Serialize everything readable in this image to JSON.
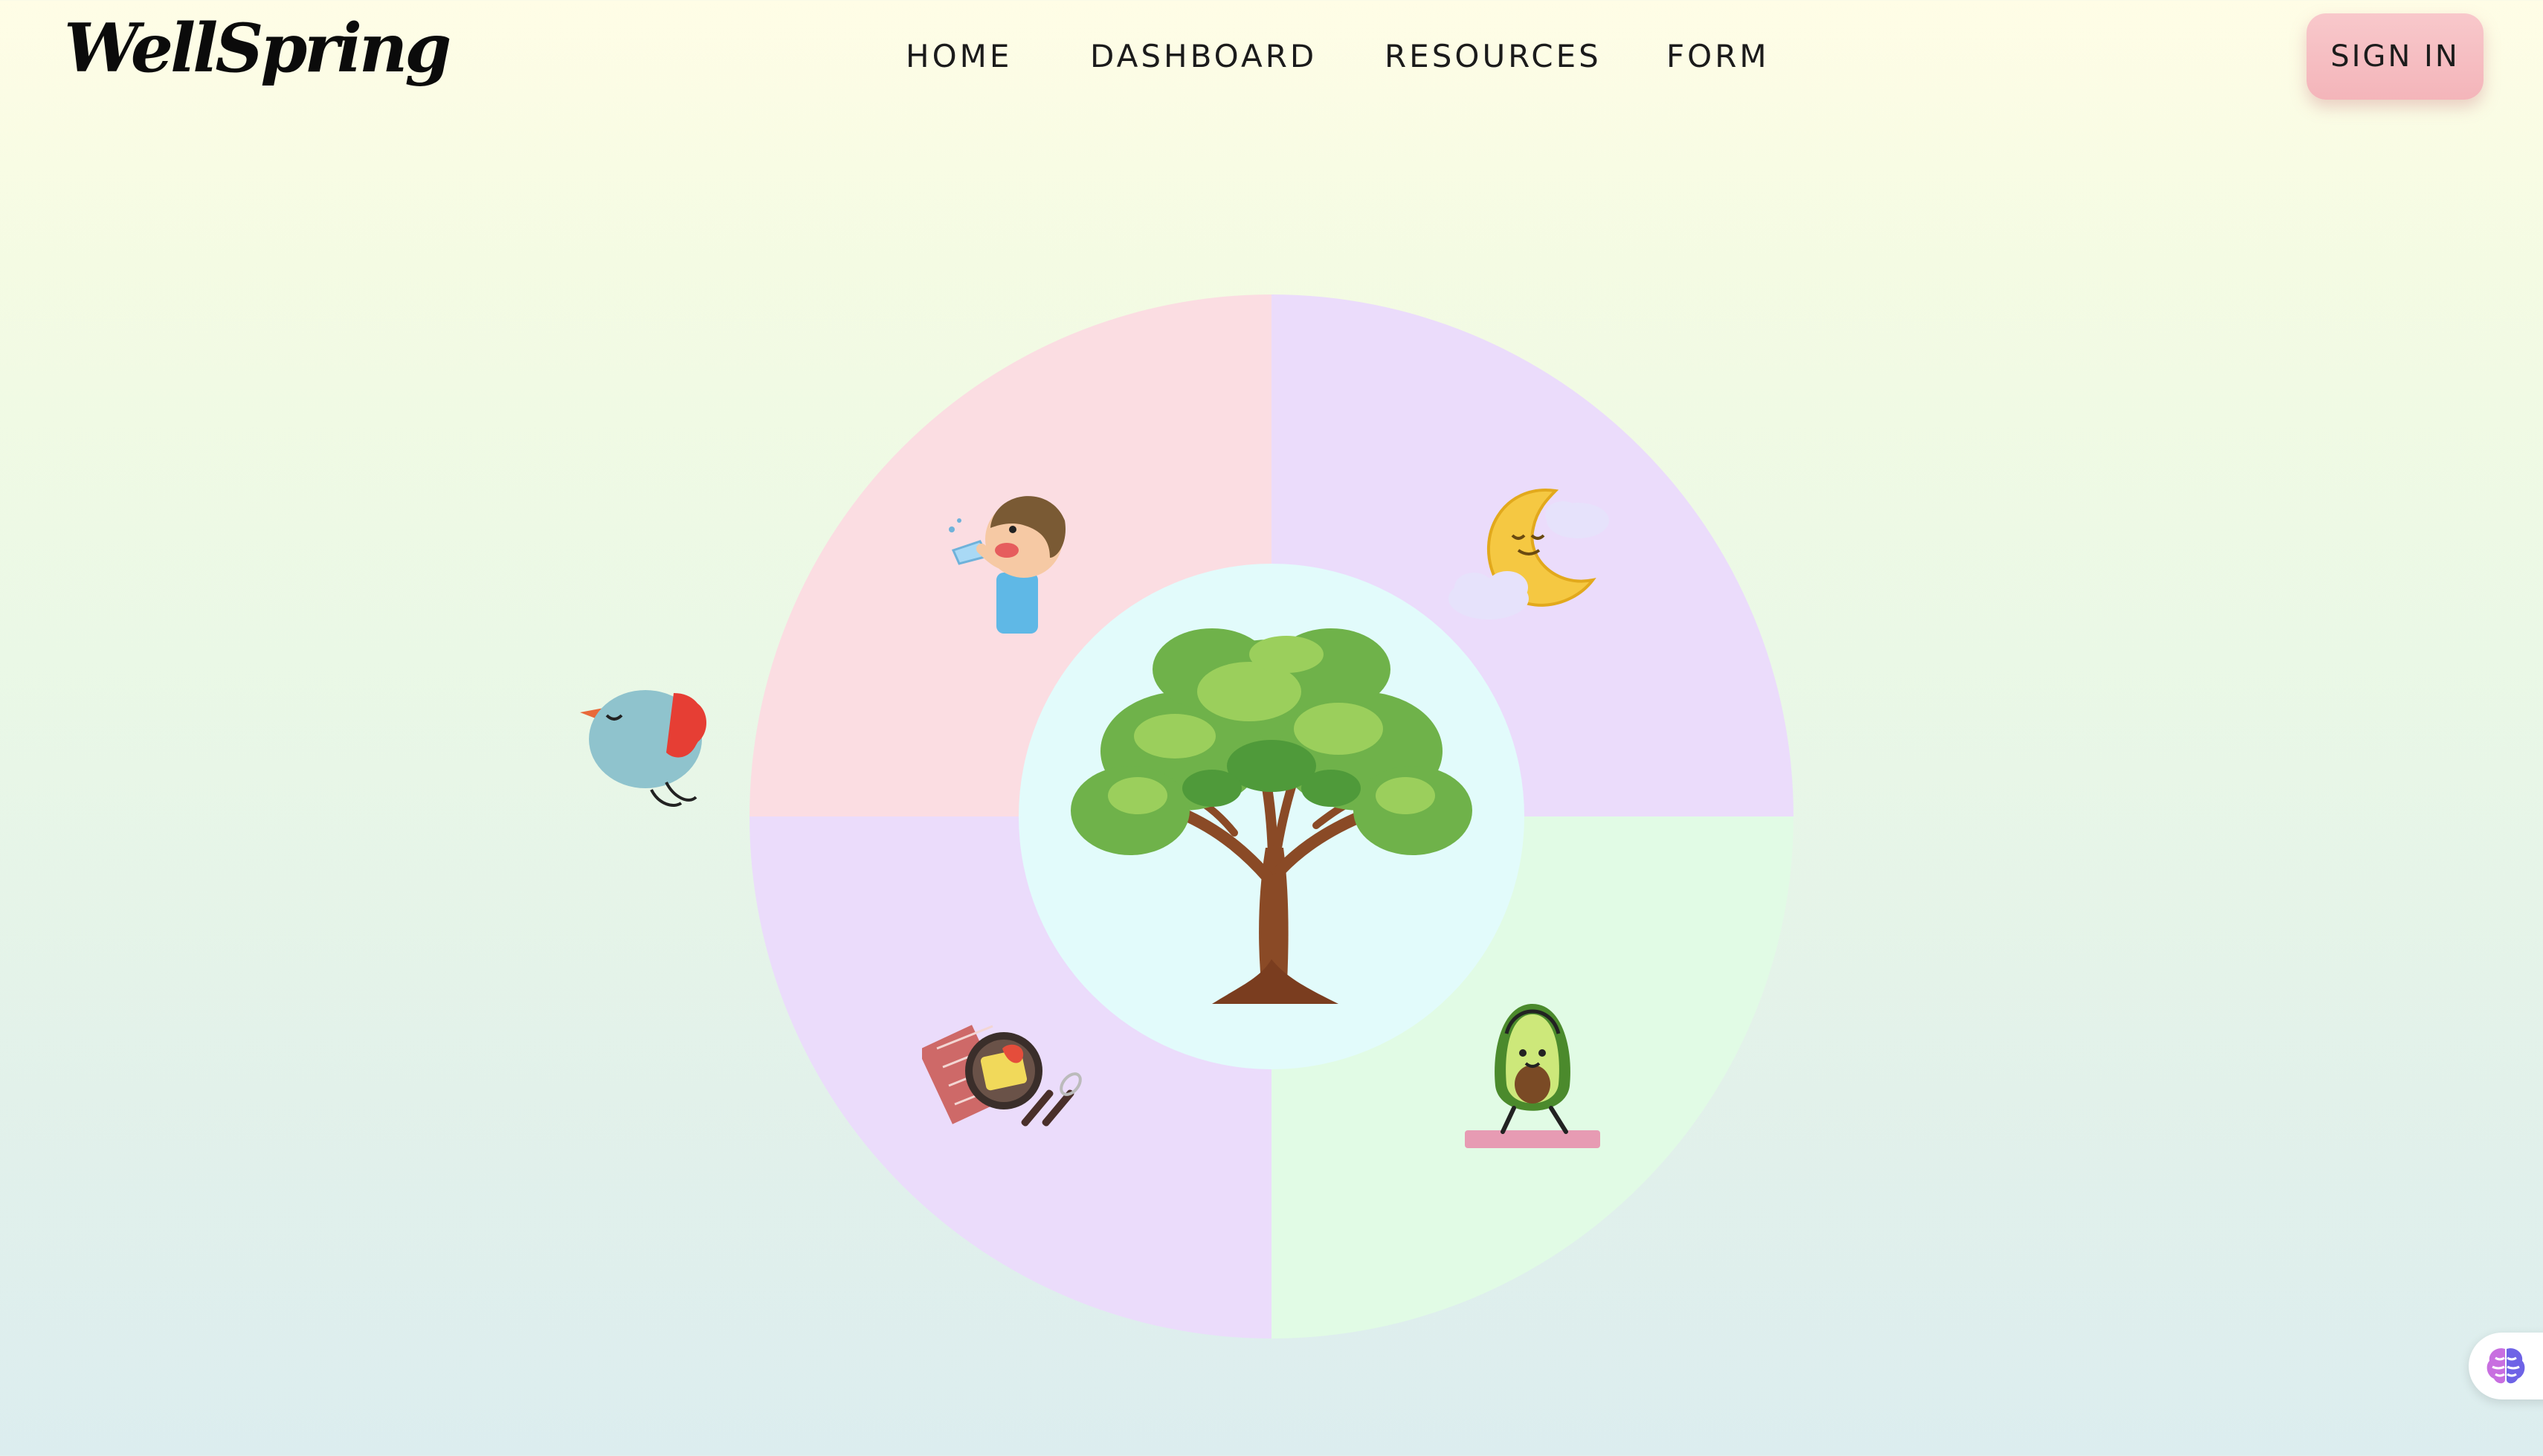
{
  "header": {
    "logo": "WellSpring",
    "nav": {
      "home": "HOME",
      "dashboard": "DASHBOARD",
      "resources": "RESOURCES",
      "form": "FORM"
    },
    "sign_in": "SIGN IN"
  },
  "wheel": {
    "quadrants": [
      {
        "name": "hydration",
        "color": "#fbdde2",
        "icon": "boy-drinking-water-icon"
      },
      {
        "name": "sleep",
        "color": "#ebdcfb",
        "icon": "moon-clouds-icon"
      },
      {
        "name": "nutrition",
        "color": "#ebdcfb",
        "icon": "meal-plate-icon"
      },
      {
        "name": "exercise",
        "color": "#e1fbe5",
        "icon": "avocado-yoga-icon"
      }
    ],
    "center": {
      "color": "#e2fbfb",
      "icon": "tree-icon"
    }
  },
  "floating": {
    "bird": "bird-icon",
    "assistant": "brain-icon"
  },
  "colors": {
    "background_top": "#fffde6",
    "background_bottom": "#dcedef",
    "sign_in": "#f4b5ba"
  }
}
